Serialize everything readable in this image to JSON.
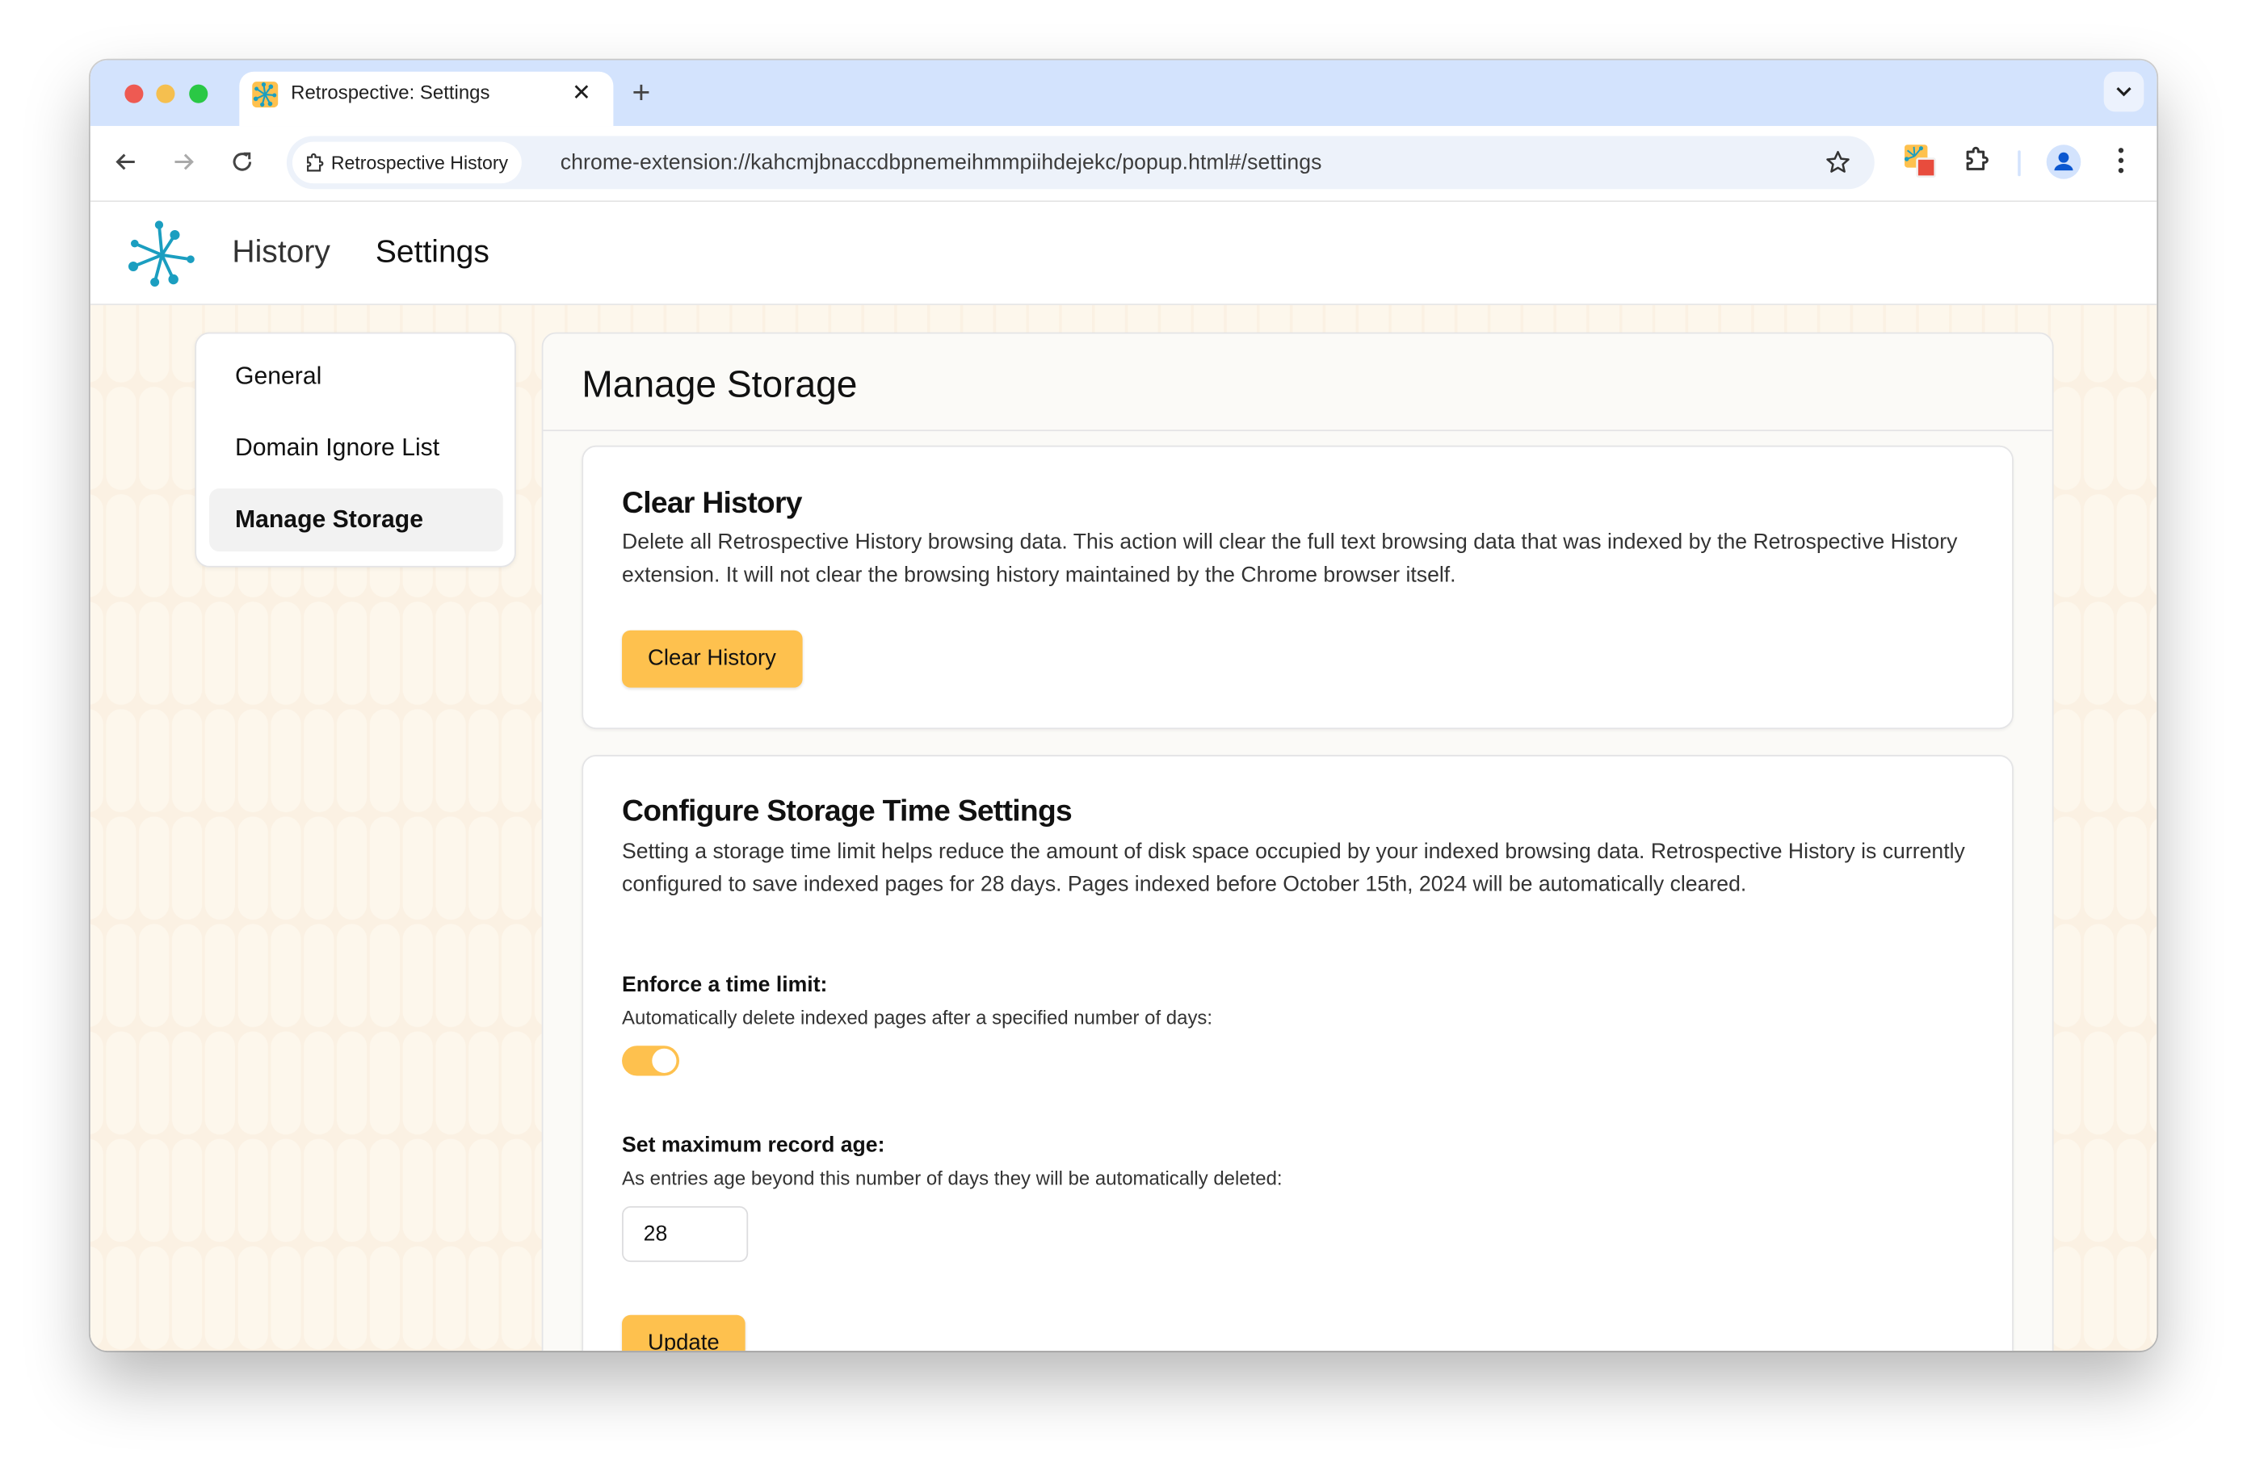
{
  "browser": {
    "tab": {
      "title": "Retrospective: Settings",
      "close_icon": "close-icon",
      "favicon": "retrospective-asterisk-icon"
    },
    "new_tab_icon": "plus-icon",
    "tab_search_icon": "chevron-down-icon",
    "nav": {
      "back_icon": "arrow-left-icon",
      "forward_icon": "arrow-right-icon",
      "reload_icon": "reload-icon"
    },
    "omnibox": {
      "chip_label": "Retrospective History",
      "chip_icon": "extension-puzzle-icon",
      "url": "chrome-extension://kahcmjbnaccdbpnemeihmmpiihdejekc/popup.html#/settings",
      "bookmark_icon": "star-icon"
    },
    "toolbar_icons": [
      "retrospective-extension-icon",
      "extensions-puzzle-icon",
      "profile-avatar-icon",
      "more-vert-icon"
    ]
  },
  "app": {
    "logo": "asterisk-logo-icon",
    "nav": [
      {
        "label": "History",
        "active": false
      },
      {
        "label": "Settings",
        "active": true
      }
    ]
  },
  "sidebar": {
    "items": [
      {
        "label": "General",
        "active": false
      },
      {
        "label": "Domain Ignore List",
        "active": false
      },
      {
        "label": "Manage Storage",
        "active": true
      }
    ]
  },
  "main": {
    "title": "Manage Storage",
    "clear_history": {
      "heading": "Clear History",
      "description": "Delete all Retrospective History browsing data. This action will clear the full text browsing data that was indexed by the Retrospective History extension. It will not clear the browsing history maintained by the Chrome browser itself.",
      "button_label": "Clear History"
    },
    "storage_time": {
      "heading": "Configure Storage Time Settings",
      "description": "Setting a storage time limit helps reduce the amount of disk space occupied by your indexed browsing data. Retrospective History is currently configured to save indexed pages for 28 days. Pages indexed before October 15th, 2024 will be automatically cleared.",
      "enforce_label": "Enforce a time limit:",
      "enforce_help": "Automatically delete indexed pages after a specified number of days:",
      "enforce_enabled": true,
      "max_age_label": "Set maximum record age:",
      "max_age_help": "As entries age beyond this number of days they will be automatically deleted:",
      "max_age_value": "28",
      "update_label": "Update"
    }
  },
  "colors": {
    "accent": "#fec14e",
    "logo": "#1b9ec0",
    "background": "#fbf1e3",
    "tabstrip": "#d3e3fd"
  }
}
